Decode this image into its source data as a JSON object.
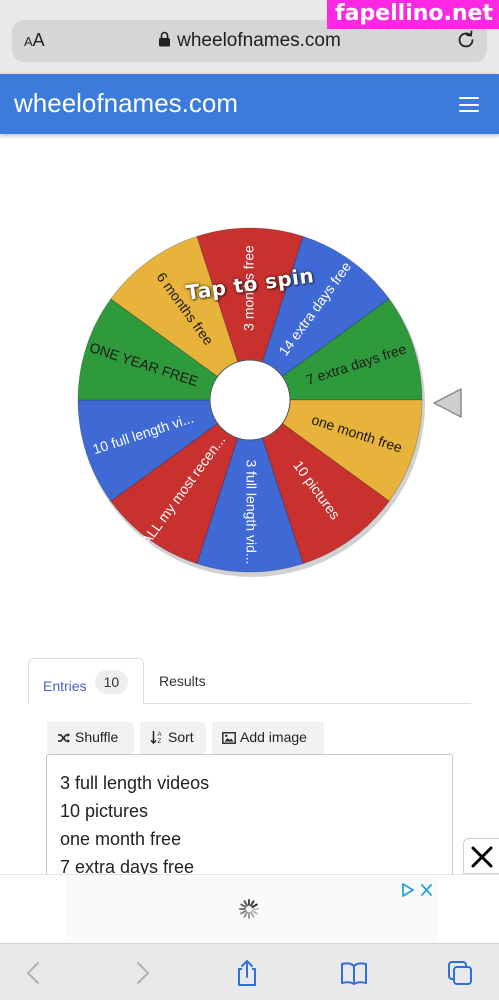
{
  "browser": {
    "aa_label_small": "A",
    "aa_label_large": "A",
    "url": "wheelofnames.com",
    "watermark": "fapellino.net"
  },
  "header": {
    "title": "wheelofnames.com"
  },
  "wheel": {
    "tap_to_spin": "Tap to spin",
    "segments": [
      {
        "label": "3 months free",
        "color": "#c9312f"
      },
      {
        "label": "14 extra days free",
        "color": "#3f6ad6"
      },
      {
        "label": "7 extra days free",
        "color": "#2f9a3c"
      },
      {
        "label": "one month free",
        "color": "#e8b33a"
      },
      {
        "label": "10 pictures",
        "color": "#c9312f"
      },
      {
        "label": "3 full length vid...",
        "color": "#3f6ad6"
      },
      {
        "label": "ALL my most recen...",
        "color": "#c9312f"
      },
      {
        "label": "10 full length vi...",
        "color": "#3f6ad6"
      },
      {
        "label": "ONE YEAR FREE",
        "color": "#2f9a3c"
      },
      {
        "label": "6 months free",
        "color": "#e8b33a"
      }
    ]
  },
  "tabs": {
    "entries_label": "Entries",
    "entries_count": "10",
    "results_label": "Results"
  },
  "toolbar": {
    "shuffle_label": "Shuffle",
    "sort_label": "Sort",
    "add_image_label": "Add image"
  },
  "entries": {
    "lines": [
      "3 full length videos",
      "10 pictures",
      "one month free",
      "7 extra days free"
    ]
  },
  "colors": {
    "header_blue": "#3a7bdb",
    "tab_accent": "#4a64c8"
  }
}
